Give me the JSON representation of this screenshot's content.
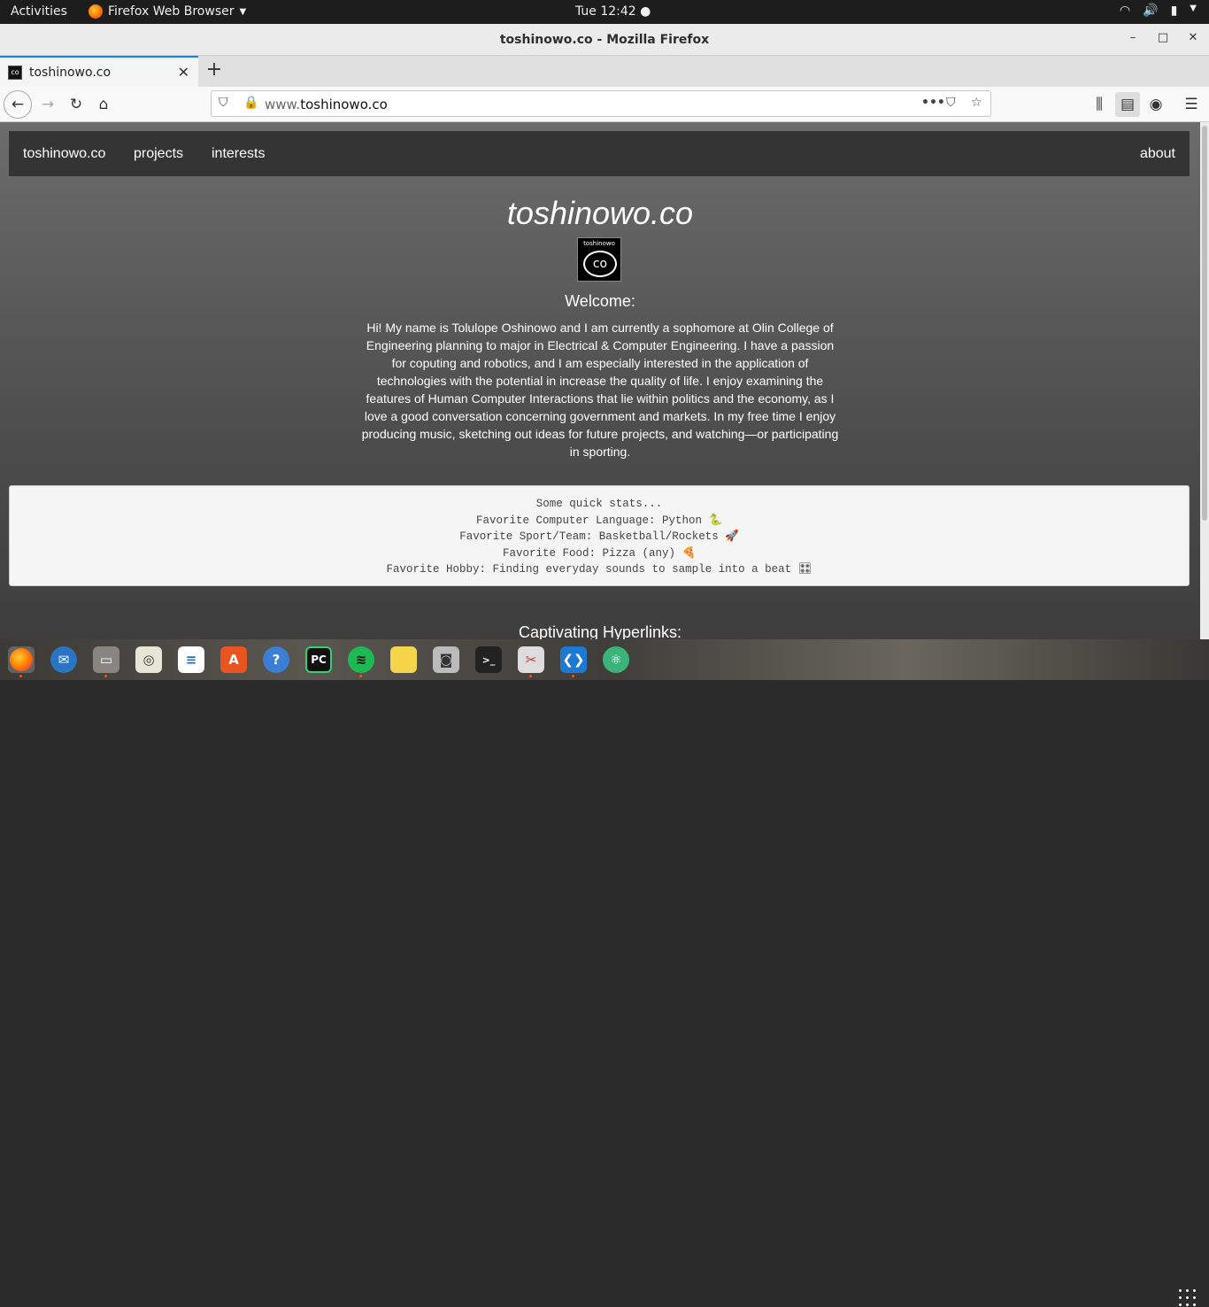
{
  "topbar": {
    "activities": "Activities",
    "app_name": "Firefox Web Browser",
    "clock": "Tue 12:42"
  },
  "window": {
    "title": "toshinowo.co - Mozilla Firefox"
  },
  "tabs": [
    {
      "label": "toshinowo.co"
    }
  ],
  "urlbar": {
    "prefix": "www.",
    "domain": "toshinowo.co"
  },
  "site": {
    "nav": {
      "brand": "toshinowo.co",
      "items": [
        "projects",
        "interests"
      ],
      "right": "about"
    },
    "title": "toshinowo.co",
    "logo_text": "toshinowo",
    "welcome": "Welcome:",
    "bio": "Hi! My name is Tolulope Oshinowo and I am currently a sophomore at Olin College of Engineering planning to major in Electrical & Computer Engineering. I have a passion for coputing and robotics, and I am especially interested in the application of technologies with the potential in increase the quality of life. I enjoy examining the features of Human Computer Interactions that lie within politics and the economy, as I love a good conversation concerning government and markets. In my free time I enjoy producing music, sketching out ideas for future projects, and watching—or participating in sporting.",
    "stats": [
      "Some quick stats...",
      "Favorite Computer Language: Python 🐍",
      "Favorite Sport/Team: Basketball/Rockets 🚀",
      "Favorite Food: Pizza (any) 🍕",
      "Favorite Hobby: Finding everyday sounds to sample into a beat 🎛"
    ],
    "links_heading": "Captivating Hyperlinks:"
  },
  "dock": [
    {
      "name": "firefox",
      "label": ""
    },
    {
      "name": "thunderbird",
      "label": ""
    },
    {
      "name": "files",
      "label": ""
    },
    {
      "name": "rhythmbox",
      "label": ""
    },
    {
      "name": "writer",
      "label": ""
    },
    {
      "name": "software",
      "label": "A"
    },
    {
      "name": "help",
      "label": "?"
    },
    {
      "name": "pycharm",
      "label": "PC"
    },
    {
      "name": "spotify",
      "label": ""
    },
    {
      "name": "notes",
      "label": ""
    },
    {
      "name": "camera",
      "label": ""
    },
    {
      "name": "terminal",
      "label": ">_"
    },
    {
      "name": "tools",
      "label": ""
    },
    {
      "name": "vscode",
      "label": ""
    },
    {
      "name": "atom",
      "label": ""
    }
  ]
}
